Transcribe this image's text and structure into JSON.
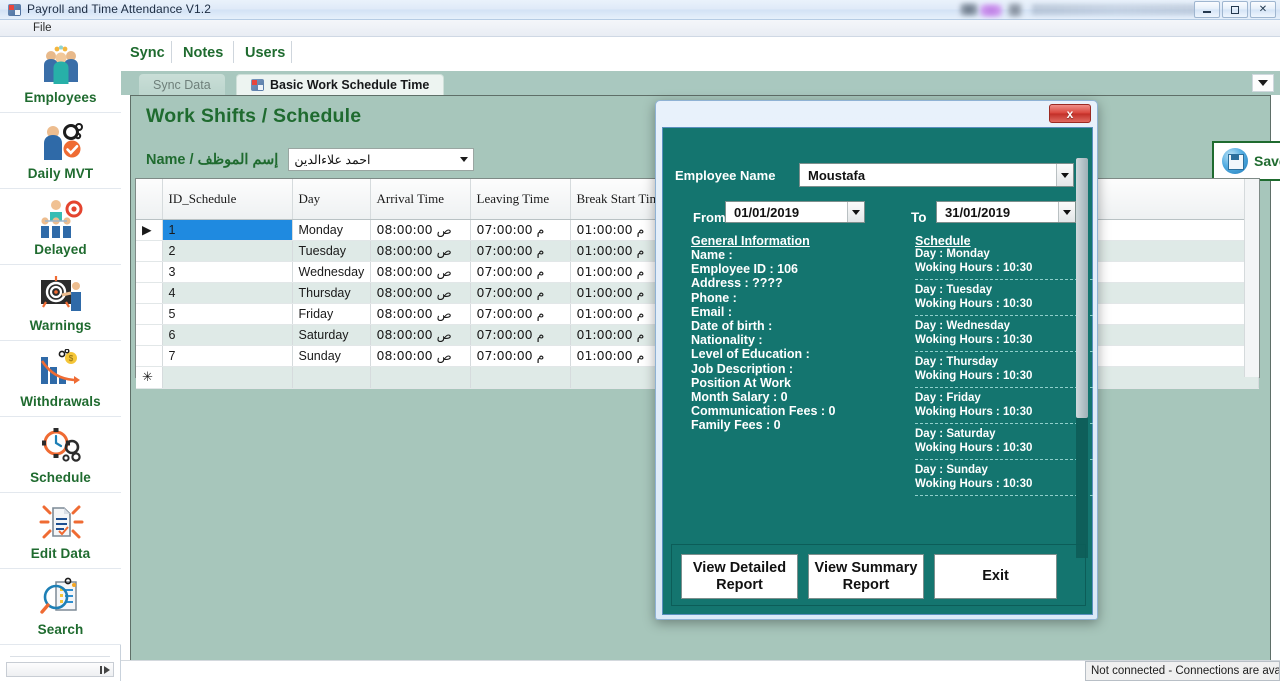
{
  "window": {
    "title": "Payroll and Time Attendance V1.2",
    "app_icon": "app-window-icon",
    "minimize": "minimize-icon",
    "maximize": "maximize-icon",
    "close": "close-icon"
  },
  "menubar": {
    "items": [
      "File"
    ]
  },
  "sidebar": {
    "items": [
      {
        "label": "Employees",
        "icon": "employees-group-icon"
      },
      {
        "label": "Daily MVT",
        "icon": "daily-movement-icon"
      },
      {
        "label": "Delayed",
        "icon": "delayed-team-icon"
      },
      {
        "label": "Warnings",
        "icon": "warnings-target-icon"
      },
      {
        "label": "Withdrawals",
        "icon": "withdrawals-chart-icon"
      },
      {
        "label": "Schedule",
        "icon": "schedule-clock-icon"
      },
      {
        "label": "Edit Data",
        "icon": "edit-data-document-icon"
      },
      {
        "label": "Search",
        "icon": "search-magnifier-icon"
      }
    ]
  },
  "topnav": {
    "items": [
      "Sync",
      "Notes",
      "Users"
    ]
  },
  "tabs": {
    "items": [
      {
        "label": "Sync Data",
        "active": false,
        "icon": null
      },
      {
        "label": "Basic Work Schedule Time",
        "active": true,
        "icon": "window-tab-icon"
      }
    ],
    "overflow_icon": "chevron-down-icon"
  },
  "main": {
    "page_title": "Work  Shifts / Schedule",
    "name_label_en": "Name /",
    "name_label_ar": "إسم الموظف",
    "name_value": "احمد علاءالدين",
    "save_button": "Save/حفظ",
    "save_icon": "save-disk-icon"
  },
  "grid": {
    "columns": [
      "ID_Schedule",
      "Day",
      "Arrival Time",
      "Leaving Time",
      "Break Start Time"
    ],
    "rows": [
      {
        "id": "1",
        "day": "Monday",
        "arrival": "08:00:00 ص",
        "leaving": "07:00:00 م",
        "break": "01:00:00 م",
        "selected": true
      },
      {
        "id": "2",
        "day": "Tuesday",
        "arrival": "08:00:00 ص",
        "leaving": "07:00:00 م",
        "break": "01:00:00 م",
        "selected": false
      },
      {
        "id": "3",
        "day": "Wednesday",
        "arrival": "08:00:00 ص",
        "leaving": "07:00:00 م",
        "break": "01:00:00 م",
        "selected": false
      },
      {
        "id": "4",
        "day": "Thursday",
        "arrival": "08:00:00 ص",
        "leaving": "07:00:00 م",
        "break": "01:00:00 م",
        "selected": false
      },
      {
        "id": "5",
        "day": "Friday",
        "arrival": "08:00:00 ص",
        "leaving": "07:00:00 م",
        "break": "01:00:00 م",
        "selected": false
      },
      {
        "id": "6",
        "day": "Saturday",
        "arrival": "08:00:00 ص",
        "leaving": "07:00:00 م",
        "break": "01:00:00 م",
        "selected": false
      },
      {
        "id": "7",
        "day": "Sunday",
        "arrival": "08:00:00 ص",
        "leaving": "07:00:00 م",
        "break": "01:00:00 م",
        "selected": false
      }
    ],
    "current_row_marker": "▶",
    "new_row_marker": "✳"
  },
  "dialog": {
    "close_label": "x",
    "employee_name_label": "Employee Name",
    "employee_name_value": "Moustafa",
    "from_label": "From",
    "from_value": "01/01/2019",
    "to_label": "To",
    "to_value": "31/01/2019",
    "general_information": {
      "heading": "General Information",
      "lines": [
        "Name :",
        "Employee ID : 106",
        "Address : ????",
        "Phone :",
        "Email :",
        "Date of birth :",
        "Nationality :",
        "Level of Education :",
        "Job Description :",
        "Position At Work",
        "Month Salary : 0",
        "Communication Fees : 0",
        "Family Fees : 0"
      ]
    },
    "schedule": {
      "heading": "Schedule",
      "entries": [
        {
          "day": "Day : Monday",
          "hours": "Woking Hours : 10:30"
        },
        {
          "day": "Day : Tuesday",
          "hours": "Woking Hours : 10:30"
        },
        {
          "day": "Day : Wednesday",
          "hours": "Woking Hours : 10:30"
        },
        {
          "day": "Day : Thursday",
          "hours": "Woking Hours : 10:30"
        },
        {
          "day": "Day : Friday",
          "hours": "Woking Hours : 10:30"
        },
        {
          "day": "Day : Saturday",
          "hours": "Woking Hours : 10:30"
        },
        {
          "day": "Day : Sunday",
          "hours": "Woking Hours : 10:30"
        }
      ]
    },
    "buttons": {
      "detailed": "View Detailed Report",
      "summary": "View Summary Report",
      "exit": "Exit"
    }
  },
  "statusbar": {
    "text": "Not connected - Connections are avail"
  },
  "colors": {
    "accent_green": "#1f6b2f",
    "dialog_teal": "#14756f",
    "workarea_teal": "#a7c6bb",
    "tabstrip": "#a9c8bf",
    "selection_blue": "#1f8ae0",
    "close_red": "#d9453c"
  }
}
